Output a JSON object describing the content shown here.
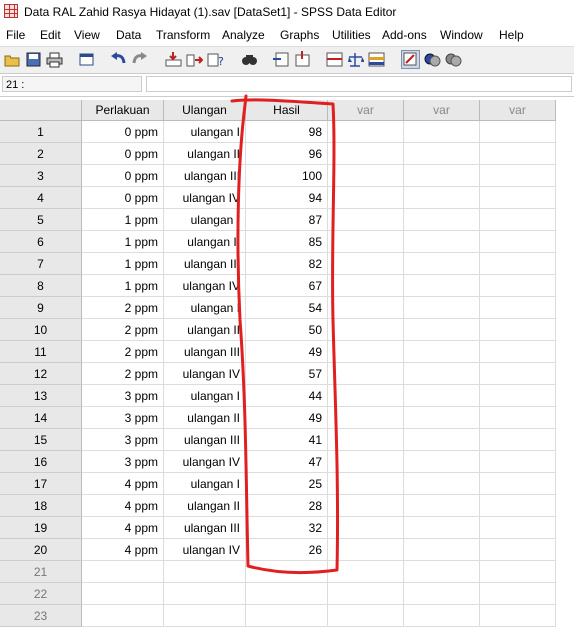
{
  "window": {
    "title": "Data RAL Zahid Rasya Hidayat (1).sav [DataSet1] - SPSS Data Editor"
  },
  "menu": [
    {
      "label": "File"
    },
    {
      "label": "Edit"
    },
    {
      "label": "View"
    },
    {
      "label": "Data"
    },
    {
      "label": "Transform"
    },
    {
      "label": "Analyze"
    },
    {
      "label": "Graphs"
    },
    {
      "label": "Utilities"
    },
    {
      "label": "Add-ons"
    },
    {
      "label": "Window"
    },
    {
      "label": "Help"
    }
  ],
  "toolbar": {
    "icons": [
      "open-icon",
      "save-icon",
      "print-icon",
      "dialog-recall-icon",
      "undo-icon",
      "redo-icon",
      "goto-case-icon",
      "goto-variable-icon",
      "variables-icon",
      "find-icon",
      "insert-cases-icon",
      "insert-variable-icon",
      "split-file-icon",
      "weight-cases-icon",
      "select-cases-icon",
      "value-labels-icon",
      "use-sets-icon",
      "show-all-icon"
    ]
  },
  "cell_editor": {
    "ref": "21 :",
    "value": ""
  },
  "columns": [
    {
      "label": "Perlakuan",
      "kind": "data"
    },
    {
      "label": "Ulangan",
      "kind": "data"
    },
    {
      "label": "Hasil",
      "kind": "data"
    },
    {
      "label": "var",
      "kind": "var"
    },
    {
      "label": "var",
      "kind": "var"
    },
    {
      "label": "var",
      "kind": "var"
    }
  ],
  "rows": [
    {
      "n": "1",
      "perlakuan": "0 ppm",
      "ulangan": "ulangan I",
      "hasil": "98"
    },
    {
      "n": "2",
      "perlakuan": "0 ppm",
      "ulangan": "ulangan II",
      "hasil": "96"
    },
    {
      "n": "3",
      "perlakuan": "0 ppm",
      "ulangan": "ulangan III",
      "hasil": "100"
    },
    {
      "n": "4",
      "perlakuan": "0 ppm",
      "ulangan": "ulangan IV",
      "hasil": "94"
    },
    {
      "n": "5",
      "perlakuan": "1 ppm",
      "ulangan": "ulangan I",
      "hasil": "87"
    },
    {
      "n": "6",
      "perlakuan": "1 ppm",
      "ulangan": "ulangan II",
      "hasil": "85"
    },
    {
      "n": "7",
      "perlakuan": "1 ppm",
      "ulangan": "ulangan III",
      "hasil": "82"
    },
    {
      "n": "8",
      "perlakuan": "1 ppm",
      "ulangan": "ulangan IV",
      "hasil": "67"
    },
    {
      "n": "9",
      "perlakuan": "2 ppm",
      "ulangan": "ulangan I",
      "hasil": "54"
    },
    {
      "n": "10",
      "perlakuan": "2 ppm",
      "ulangan": "ulangan II",
      "hasil": "50"
    },
    {
      "n": "11",
      "perlakuan": "2 ppm",
      "ulangan": "ulangan III",
      "hasil": "49"
    },
    {
      "n": "12",
      "perlakuan": "2 ppm",
      "ulangan": "ulangan IV",
      "hasil": "57"
    },
    {
      "n": "13",
      "perlakuan": "3 ppm",
      "ulangan": "ulangan I",
      "hasil": "44"
    },
    {
      "n": "14",
      "perlakuan": "3 ppm",
      "ulangan": "ulangan II",
      "hasil": "49"
    },
    {
      "n": "15",
      "perlakuan": "3 ppm",
      "ulangan": "ulangan III",
      "hasil": "41"
    },
    {
      "n": "16",
      "perlakuan": "3 ppm",
      "ulangan": "ulangan IV",
      "hasil": "47"
    },
    {
      "n": "17",
      "perlakuan": "4 ppm",
      "ulangan": "ulangan I",
      "hasil": "25"
    },
    {
      "n": "18",
      "perlakuan": "4 ppm",
      "ulangan": "ulangan II",
      "hasil": "28"
    },
    {
      "n": "19",
      "perlakuan": "4 ppm",
      "ulangan": "ulangan III",
      "hasil": "32"
    },
    {
      "n": "20",
      "perlakuan": "4 ppm",
      "ulangan": "ulangan IV",
      "hasil": "26"
    }
  ],
  "empty_rows": [
    "21",
    "22",
    "23"
  ],
  "colors": {
    "annotation": "#e02020",
    "header_bg": "#e8e8e8"
  }
}
